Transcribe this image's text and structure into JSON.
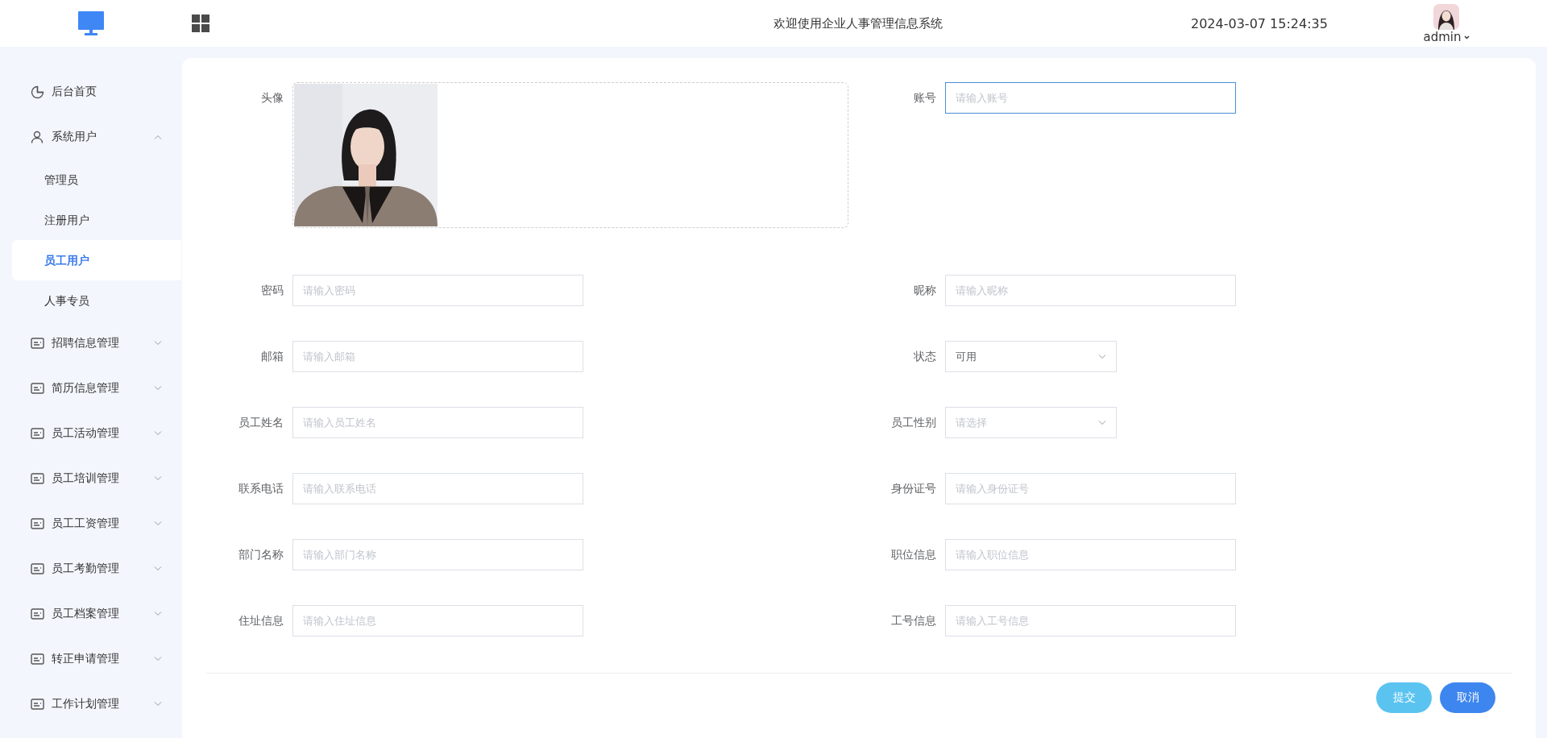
{
  "header": {
    "title": "欢迎使用企业人事管理信息系统",
    "datetime": "2024-03-07 15:24:35",
    "user": "admin"
  },
  "sidebar": {
    "items": [
      {
        "label": "后台首页",
        "kind": "home"
      },
      {
        "label": "系统用户",
        "kind": "users",
        "expanded": true,
        "children": [
          {
            "label": "管理员",
            "selected": false
          },
          {
            "label": "注册用户",
            "selected": false
          },
          {
            "label": "员工用户",
            "selected": true
          },
          {
            "label": "人事专员",
            "selected": false
          }
        ]
      },
      {
        "label": "招聘信息管理",
        "kind": "module",
        "expanded": false
      },
      {
        "label": "简历信息管理",
        "kind": "module",
        "expanded": false
      },
      {
        "label": "员工活动管理",
        "kind": "module",
        "expanded": false
      },
      {
        "label": "员工培训管理",
        "kind": "module",
        "expanded": false
      },
      {
        "label": "员工工资管理",
        "kind": "module",
        "expanded": false
      },
      {
        "label": "员工考勤管理",
        "kind": "module",
        "expanded": false
      },
      {
        "label": "员工档案管理",
        "kind": "module",
        "expanded": false
      },
      {
        "label": "转正申请管理",
        "kind": "module",
        "expanded": false
      },
      {
        "label": "工作计划管理",
        "kind": "module",
        "expanded": false
      }
    ]
  },
  "form": {
    "fields": [
      {
        "label": "头像",
        "kind": "upload"
      },
      {
        "label": "账号",
        "kind": "text",
        "placeholder": "请输入账号",
        "focused": true
      },
      {
        "label": "密码",
        "kind": "text",
        "placeholder": "请输入密码",
        "focused": false
      },
      {
        "label": "昵称",
        "kind": "text",
        "placeholder": "请输入昵称",
        "focused": false
      },
      {
        "label": "邮箱",
        "kind": "text",
        "placeholder": "请输入邮箱",
        "focused": false
      },
      {
        "label": "状态",
        "kind": "select",
        "value": "可用"
      },
      {
        "label": "员工姓名",
        "kind": "text",
        "placeholder": "请输入员工姓名",
        "focused": false
      },
      {
        "label": "员工性别",
        "kind": "select",
        "placeholder": "请选择"
      },
      {
        "label": "联系电话",
        "kind": "text",
        "placeholder": "请输入联系电话",
        "focused": false
      },
      {
        "label": "身份证号",
        "kind": "text",
        "placeholder": "请输入身份证号",
        "focused": false
      },
      {
        "label": "部门名称",
        "kind": "text",
        "placeholder": "请输入部门名称",
        "focused": false
      },
      {
        "label": "职位信息",
        "kind": "text",
        "placeholder": "请输入职位信息",
        "focused": false
      },
      {
        "label": "住址信息",
        "kind": "text",
        "placeholder": "请输入住址信息",
        "focused": false
      },
      {
        "label": "工号信息",
        "kind": "text",
        "placeholder": "请输入工号信息",
        "focused": false
      }
    ],
    "buttons": [
      {
        "label": "提交",
        "kind": "submit"
      },
      {
        "label": "取消",
        "kind": "cancel"
      }
    ]
  }
}
